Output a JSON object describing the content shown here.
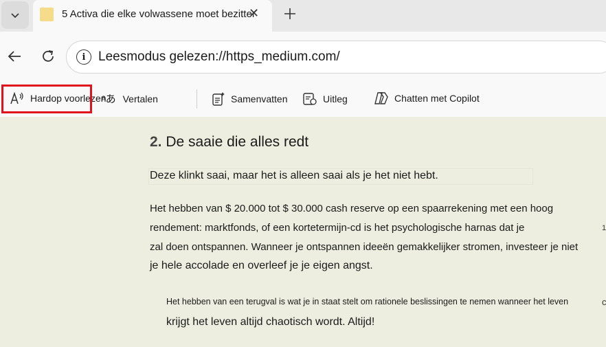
{
  "tabs": {
    "active_title": "5 Activa die elke volwassene moet bezitten"
  },
  "address_bar": {
    "url": "Leesmodus gelezen://https_medium.com/"
  },
  "reader_toolbar": {
    "read_aloud": "Hardop voorlezen",
    "translate": "Vertalen",
    "summarize": "Samenvatten",
    "explain": "Uitleg",
    "chat": "Chatten met Copilot"
  },
  "article": {
    "heading_number": "2.",
    "heading_text": "De saaie die alles redt",
    "intro": "Deze klinkt saai, maar het is alleen saai als je het niet hebt.",
    "para1_line1": "Het hebben van $ 20.000 tot $ 30.000 cash reserve op een spaarrekening met een hoog",
    "para1_line2": "rendement: marktfonds, of een kortetermijn-cd is het psychologische harnas dat je",
    "para1_line3": "zal doen ontspannen. Wanneer je ontspannen ideeën gemakkelijker stromen, investeer je niet",
    "para1_line4": "je hele accolade en overleef je je eigen angst.",
    "quote_line1": "Het hebben van een terugval is wat je in staat stelt om rationele beslissingen te nemen wanneer het leven",
    "quote_line2": "krijgt het leven altijd chaotisch wordt. Altijd!",
    "stray_mark_1": "1",
    "stray_mark_2": "c"
  },
  "colors": {
    "reader_background": "#eeeee0",
    "highlight_border": "#e0121b",
    "tab_favicon": "#f5dc8a"
  }
}
